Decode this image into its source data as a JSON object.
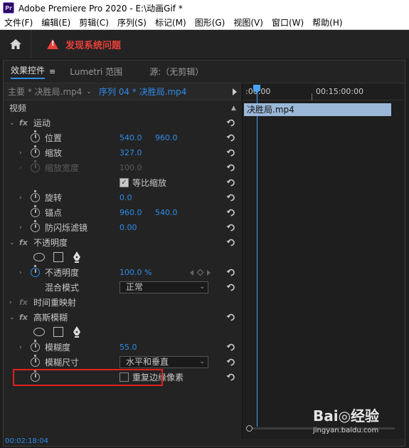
{
  "window": {
    "title": "Adobe Premiere Pro 2020 - E:\\动画Gif *",
    "logo_text": "Pr"
  },
  "menu": [
    "文件(F)",
    "编辑(E)",
    "剪辑(C)",
    "序列(S)",
    "标记(M)",
    "图形(G)",
    "视图(V)",
    "窗口(W)",
    "帮助(H)"
  ],
  "toolbar": {
    "warning_text": "发现系统问题"
  },
  "tabs": [
    {
      "label": "效果控件",
      "active": true
    },
    {
      "label": "Lumetri 范围",
      "active": false
    },
    {
      "label": "源:（无剪辑）",
      "active": false
    }
  ],
  "source": {
    "master": "主要 * 决胜局.mp4",
    "sequence": "序列 04 * 决胜局.mp4"
  },
  "sections": {
    "video": "视频",
    "motion": "运动",
    "opacity_group": "不透明度",
    "time_remap": "时间重映射",
    "gaussian": "高斯模糊"
  },
  "params": {
    "position": {
      "label": "位置",
      "x": "540.0",
      "y": "960.0"
    },
    "scale": {
      "label": "缩放",
      "value": "327.0"
    },
    "scale_width": {
      "label": "缩放宽度",
      "value": "100.0"
    },
    "uniform_scale": {
      "label": "等比缩放",
      "checked": true
    },
    "rotation": {
      "label": "旋转",
      "value": "0.0"
    },
    "anchor": {
      "label": "锚点",
      "x": "960.0",
      "y": "540.0"
    },
    "anti_flicker": {
      "label": "防闪烁滤镜",
      "value": "0.00"
    },
    "opacity": {
      "label": "不透明度",
      "value": "100.0 %"
    },
    "blend_mode": {
      "label": "混合模式",
      "value": "正常"
    },
    "blurriness": {
      "label": "模糊度",
      "value": "55.0"
    },
    "blur_dims": {
      "label": "模糊尺寸",
      "value": "水平和垂直"
    },
    "repeat_edge": {
      "label": "重复边缘像素",
      "checked": false
    }
  },
  "timeline": {
    "t_start": ":00:00",
    "t_mid": "00:15:00:00",
    "clip_name": "决胜局.mp4"
  },
  "status": {
    "timecode": "00:02:18:04"
  },
  "watermark": {
    "main": "Bai◎经验",
    "sub": "jingyan.baidu.com"
  },
  "colors": {
    "accent": "#2d8ceb",
    "warning": "#e8403a",
    "clip": "#9ab8d8",
    "highlight": "#e02020"
  }
}
